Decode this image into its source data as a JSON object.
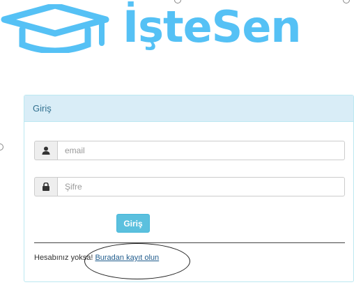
{
  "logo": {
    "text": "İşteSen",
    "icon": "graduation-cap-icon",
    "color": "#55c1f5"
  },
  "panel": {
    "heading": "Giriş",
    "email": {
      "placeholder": "email",
      "icon": "user-icon"
    },
    "password": {
      "placeholder": "Şifre",
      "icon": "lock-icon"
    },
    "submit_label": "Giriş",
    "register_prefix": "Hesabınız yoksa! ",
    "register_link": "Buradan kayıt olun"
  },
  "colors": {
    "accent": "#5bc0de",
    "heading_bg": "#d9edf7",
    "heading_text": "#31708f",
    "link": "#1f5b8c"
  }
}
